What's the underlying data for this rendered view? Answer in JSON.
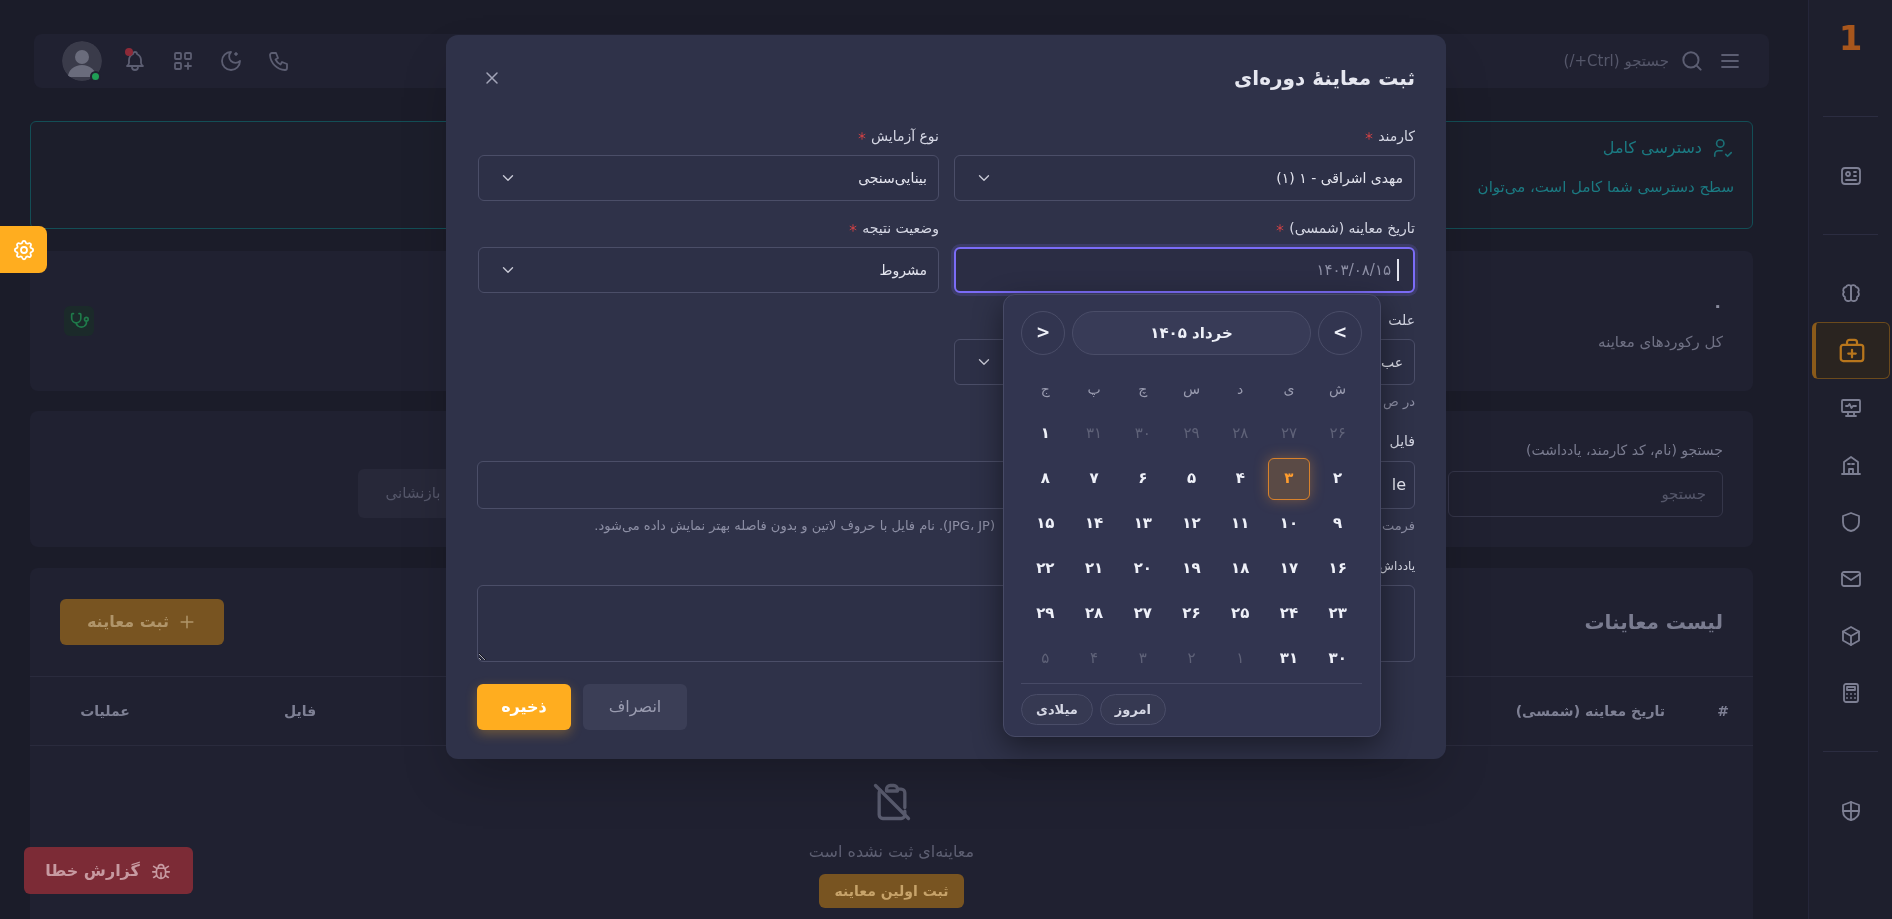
{
  "sidebar": {
    "logo": "1",
    "groups": [
      {
        "items": [
          {
            "kind": "idcard",
            "selected": false
          }
        ]
      },
      {
        "items": [
          {
            "kind": "brain",
            "selected": false
          },
          {
            "kind": "medkit",
            "selected": true
          },
          {
            "kind": "monitor",
            "selected": false
          },
          {
            "kind": "building",
            "selected": false
          },
          {
            "kind": "shield",
            "selected": false
          },
          {
            "kind": "mail",
            "selected": false
          },
          {
            "kind": "box",
            "selected": false
          },
          {
            "kind": "calculator",
            "selected": false
          }
        ]
      },
      {
        "items": [
          {
            "kind": "shieldhalf",
            "selected": false
          }
        ]
      }
    ]
  },
  "topbar": {
    "search_placeholder": "جستجو (Ctrl+/)",
    "notifications_unread": true,
    "user_online": true
  },
  "access_alert": {
    "title": "دسترسی کامل",
    "text": "سطح دسترسی شما کامل است، می‌توان"
  },
  "stats": {
    "value": "۰",
    "label": "کل رکوردهای معاینه"
  },
  "filters": {
    "search_label": "جستجو (نام، کد کارمند، یادداشت)",
    "search_placeholder": "جستجو",
    "reset_button": "بازنشانی"
  },
  "list": {
    "title": "لیست معاینات",
    "add_button": "ثبت معاینه",
    "columns": [
      "#",
      "تاریخ معاینه (شمسی)",
      "فایل",
      "عملیات"
    ],
    "empty_text": "معاینه‌ای ثبت نشده است",
    "empty_button": "ثبت اولین معاینه"
  },
  "bug_report_button": "گزارش خطا",
  "modal": {
    "title": "ثبت معاینهٔ دوره‌ای",
    "rows": [
      {
        "fields": [
          {
            "kind": "select",
            "label": "کارمند",
            "required": true,
            "value": "مهدی اشراقی - ۱ (۱)"
          },
          {
            "kind": "select",
            "label": "نوع آزمایش",
            "required": true,
            "value": "بینایی‌سنجی"
          }
        ]
      },
      {
        "fields": [
          {
            "kind": "date",
            "label": "تاریخ معاینه (شمسی)",
            "required": true,
            "placeholder": "۱۴۰۳/۰۸/۱۵",
            "focused": true
          },
          {
            "kind": "select",
            "label": "وضعیت نتیجه",
            "required": true,
            "value": "مشروط"
          }
        ]
      },
      {
        "fields": [
          {
            "kind": "select",
            "label": "علت",
            "required": false,
            "value": "عب",
            "hint": "در ص"
          }
        ]
      },
      {
        "fields": [
          {
            "kind": "file",
            "label": "فایل",
            "required": false,
            "value": "le",
            "hint_parts": [
              "فرمت",
              "(JPG، JP). نام فایل با حروف لاتین و بدون فاصله بهتر نمایش داده می‌شود."
            ]
          }
        ]
      },
      {
        "fields": [
          {
            "kind": "textarea",
            "label": "یادداش",
            "required": false
          }
        ]
      }
    ],
    "buttons": [
      {
        "kind": "secondary",
        "label": "انصراف"
      },
      {
        "kind": "primary",
        "label": "ذخیره"
      }
    ]
  },
  "datepicker": {
    "next_button": "<",
    "month_label": "خرداد ۱۴۰۵",
    "prev_button": ">",
    "weekdays": [
      "ش",
      "ی",
      "د",
      "س",
      "چ",
      "پ",
      "ج"
    ],
    "days": [
      {
        "label": "۲۶",
        "outside": true,
        "selected": false
      },
      {
        "label": "۲۷",
        "outside": true,
        "selected": false
      },
      {
        "label": "۲۸",
        "outside": true,
        "selected": false
      },
      {
        "label": "۲۹",
        "outside": true,
        "selected": false
      },
      {
        "label": "۳۰",
        "outside": true,
        "selected": false
      },
      {
        "label": "۳۱",
        "outside": true,
        "selected": false
      },
      {
        "label": "۱",
        "outside": false,
        "selected": false
      },
      {
        "label": "۲",
        "outside": false,
        "selected": false
      },
      {
        "label": "۳",
        "outside": false,
        "selected": true
      },
      {
        "label": "۴",
        "outside": false,
        "selected": false
      },
      {
        "label": "۵",
        "outside": false,
        "selected": false
      },
      {
        "label": "۶",
        "outside": false,
        "selected": false
      },
      {
        "label": "۷",
        "outside": false,
        "selected": false
      },
      {
        "label": "۸",
        "outside": false,
        "selected": false
      },
      {
        "label": "۹",
        "outside": false,
        "selected": false
      },
      {
        "label": "۱۰",
        "outside": false,
        "selected": false
      },
      {
        "label": "۱۱",
        "outside": false,
        "selected": false
      },
      {
        "label": "۱۲",
        "outside": false,
        "selected": false
      },
      {
        "label": "۱۳",
        "outside": false,
        "selected": false
      },
      {
        "label": "۱۴",
        "outside": false,
        "selected": false
      },
      {
        "label": "۱۵",
        "outside": false,
        "selected": false
      },
      {
        "label": "۱۶",
        "outside": false,
        "selected": false
      },
      {
        "label": "۱۷",
        "outside": false,
        "selected": false
      },
      {
        "label": "۱۸",
        "outside": false,
        "selected": false
      },
      {
        "label": "۱۹",
        "outside": false,
        "selected": false
      },
      {
        "label": "۲۰",
        "outside": false,
        "selected": false
      },
      {
        "label": "۲۱",
        "outside": false,
        "selected": false
      },
      {
        "label": "۲۲",
        "outside": false,
        "selected": false
      },
      {
        "label": "۲۳",
        "outside": false,
        "selected": false
      },
      {
        "label": "۲۴",
        "outside": false,
        "selected": false
      },
      {
        "label": "۲۵",
        "outside": false,
        "selected": false
      },
      {
        "label": "۲۶",
        "outside": false,
        "selected": false
      },
      {
        "label": "۲۷",
        "outside": false,
        "selected": false
      },
      {
        "label": "۲۸",
        "outside": false,
        "selected": false
      },
      {
        "label": "۲۹",
        "outside": false,
        "selected": false
      },
      {
        "label": "۳۰",
        "outside": false,
        "selected": false
      },
      {
        "label": "۳۱",
        "outside": false,
        "selected": false
      },
      {
        "label": "۱",
        "outside": true,
        "selected": false
      },
      {
        "label": "۲",
        "outside": true,
        "selected": false
      },
      {
        "label": "۳",
        "outside": true,
        "selected": false
      },
      {
        "label": "۴",
        "outside": true,
        "selected": false
      },
      {
        "label": "۵",
        "outside": true,
        "selected": false
      }
    ],
    "footer_buttons": [
      "امروز",
      "میلادی"
    ]
  }
}
